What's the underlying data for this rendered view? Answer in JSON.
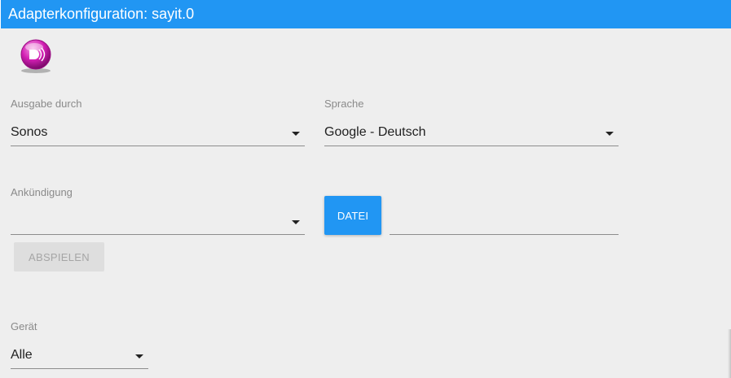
{
  "window": {
    "title": "Adapterkonfiguration: sayit.0"
  },
  "logo": {
    "icon": "sayit-logo-icon",
    "color": "#d21fb3"
  },
  "fields": {
    "ausgabe": {
      "label": "Ausgabe durch",
      "value": "Sonos"
    },
    "sprache": {
      "label": "Sprache",
      "value": "Google - Deutsch"
    },
    "ankuendigung": {
      "label": "Ankündigung",
      "value": ""
    },
    "geraet": {
      "label": "Gerät",
      "value": "Alle"
    }
  },
  "buttons": {
    "datei": "DATEI",
    "abspielen": "ABSPIELEN"
  },
  "colors": {
    "accent": "#2196f3",
    "background": "#eeeeee"
  }
}
